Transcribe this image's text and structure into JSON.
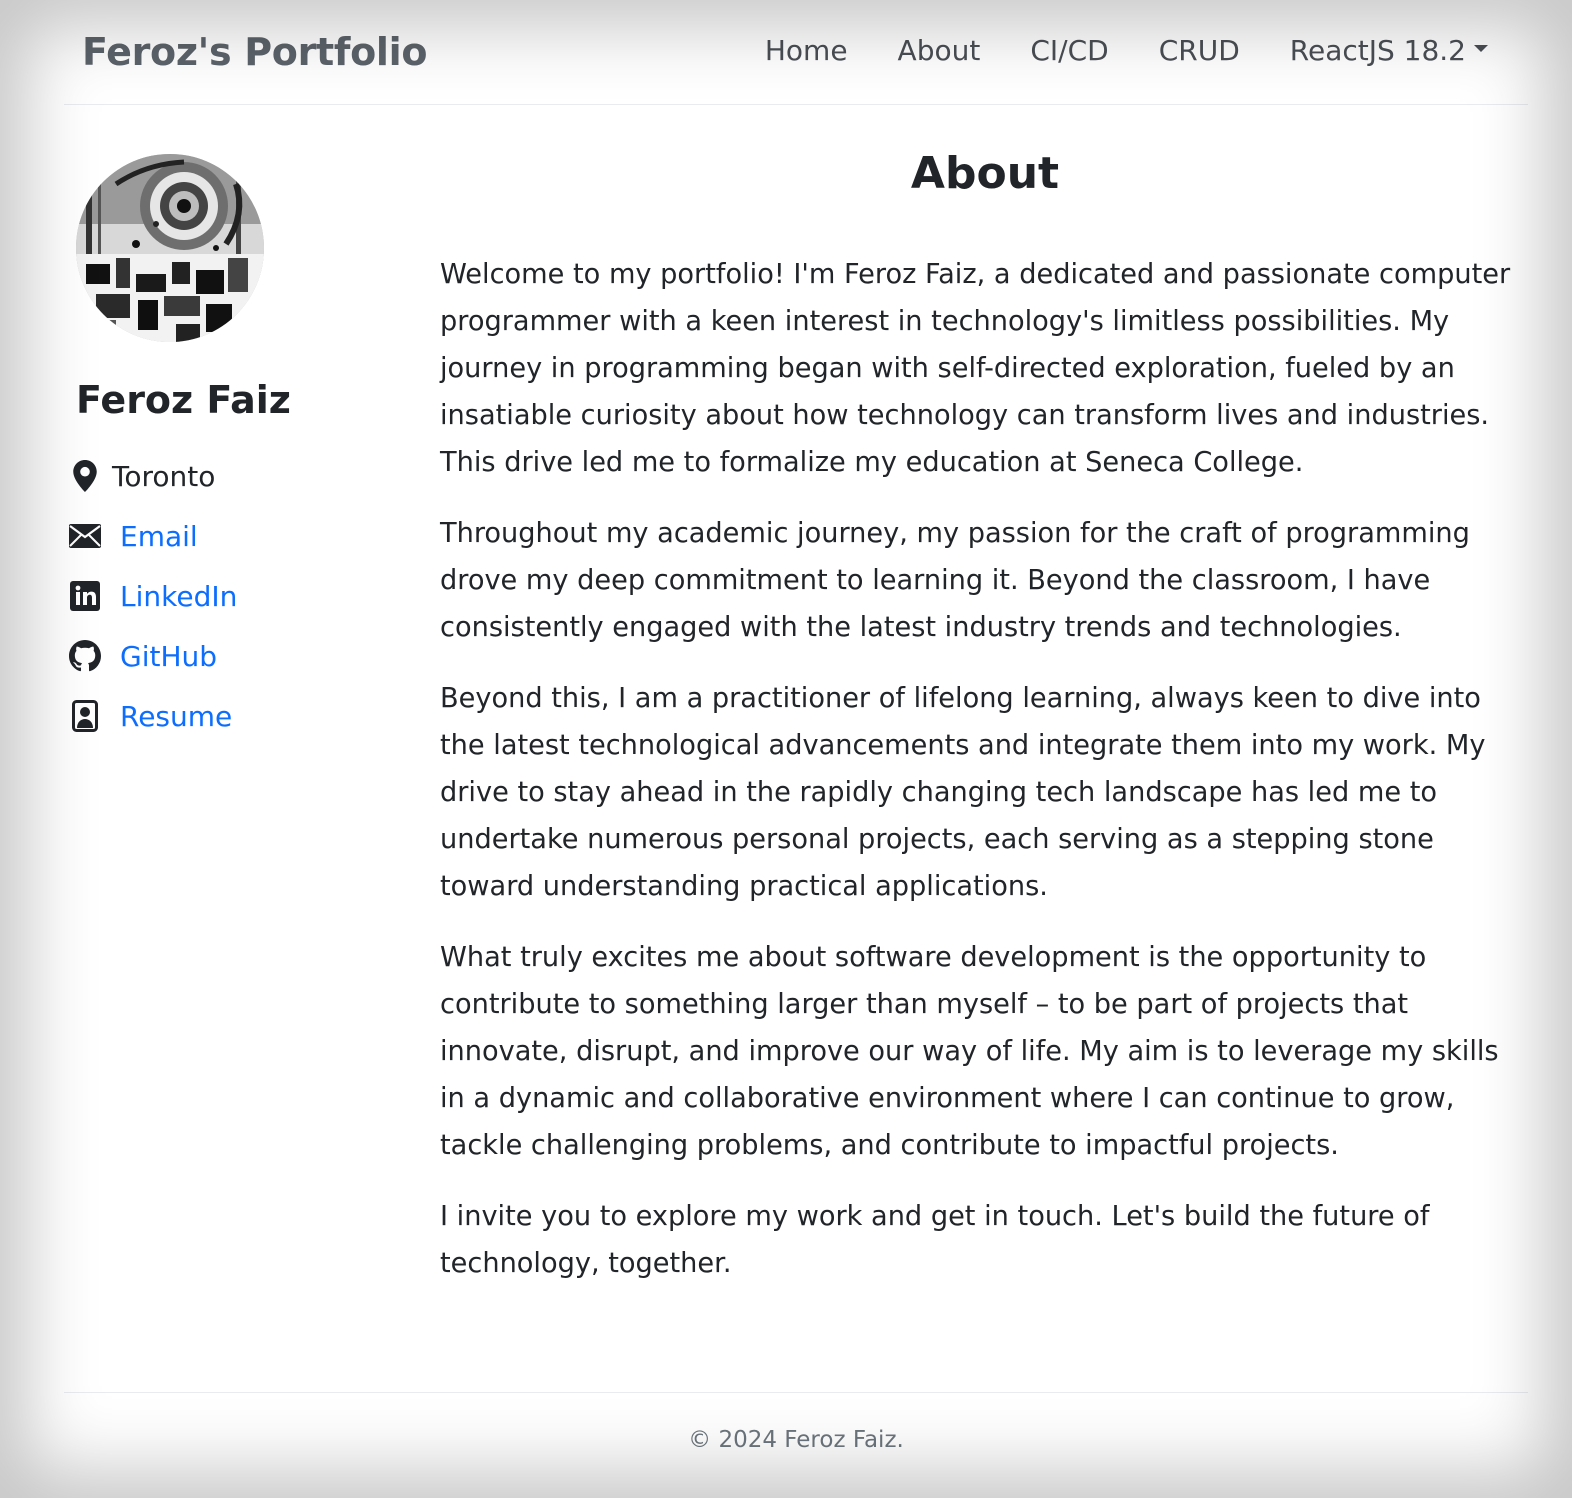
{
  "navbar": {
    "brand": "Feroz's Portfolio",
    "links": [
      {
        "label": "Home"
      },
      {
        "label": "About"
      },
      {
        "label": "CI/CD"
      },
      {
        "label": "CRUD"
      },
      {
        "label": "ReactJS 18.2"
      }
    ]
  },
  "profile": {
    "name": "Feroz Faiz",
    "location": "Toronto",
    "contacts": [
      {
        "label": "Email",
        "icon": "envelope-icon"
      },
      {
        "label": "LinkedIn",
        "icon": "linkedin-icon"
      },
      {
        "label": "GitHub",
        "icon": "github-icon"
      },
      {
        "label": "Resume",
        "icon": "person-badge-icon"
      }
    ]
  },
  "main": {
    "title": "About",
    "paragraphs": [
      "Welcome to my portfolio! I'm Feroz Faiz, a dedicated and passionate computer programmer with a keen interest in technology's limitless possibilities. My journey in programming began with self-directed exploration, fueled by an insatiable curiosity about how technology can transform lives and industries. This drive led me to formalize my education at Seneca College.",
      "Throughout my academic journey, my passion for the craft of programming drove my deep commitment to learning it. Beyond the classroom, I have consistently engaged with the latest industry trends and technologies.",
      "Beyond this, I am a practitioner of lifelong learning, always keen to dive into the latest technological advancements and integrate them into my work. My drive to stay ahead in the rapidly changing tech landscape has led me to undertake numerous personal projects, each serving as a stepping stone toward understanding practical applications.",
      "What truly excites me about software development is the opportunity to contribute to something larger than myself – to be part of projects that innovate, disrupt, and improve our way of life. My aim is to leverage my skills in a dynamic and collaborative environment where I can continue to grow, tackle challenging problems, and contribute to impactful projects.",
      "I invite you to explore my work and get in touch. Let's build the future of technology, together."
    ]
  },
  "footer": {
    "copyright": "© 2024 Feroz Faiz."
  },
  "colors": {
    "link": "#0d6efd",
    "text": "#212529",
    "muted": "#6c757d",
    "brand": "#5c636a"
  }
}
